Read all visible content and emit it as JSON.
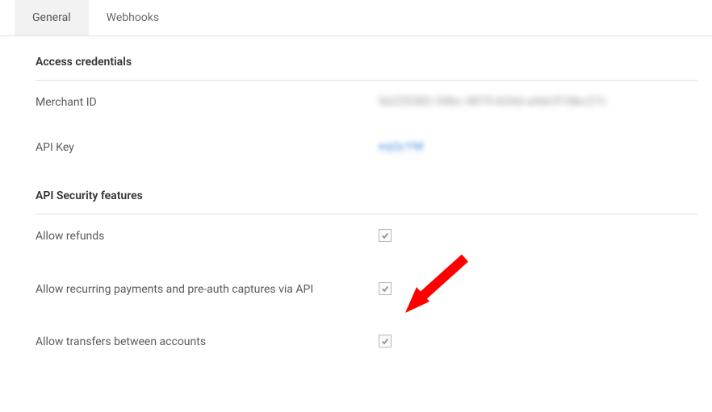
{
  "tabs": {
    "general": "General",
    "webhooks": "Webhooks",
    "active": "general"
  },
  "sections": {
    "credentials": {
      "title": "Access credentials",
      "merchant_id_label": "Merchant ID",
      "merchant_id_value": "5e235382-34bc-4879-b54d-a4dc97dbc27c",
      "api_key_label": "API Key",
      "api_key_value": "eqQcYM"
    },
    "security": {
      "title": "API Security features",
      "items": [
        {
          "label": "Allow refunds",
          "checked": true
        },
        {
          "label": "Allow recurring payments and pre-auth captures via API",
          "checked": true
        },
        {
          "label": "Allow transfers between accounts",
          "checked": true
        }
      ]
    }
  }
}
